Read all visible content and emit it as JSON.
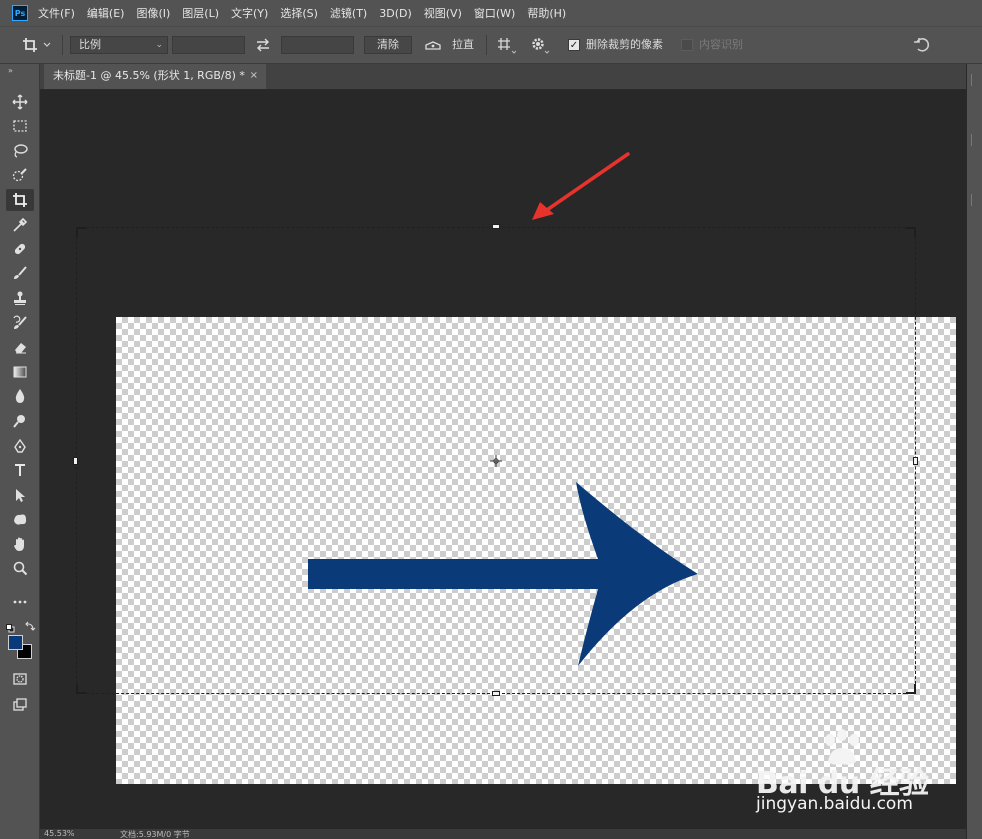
{
  "app": {
    "logo": "Ps"
  },
  "menu": {
    "items": [
      {
        "label": "文件(F)"
      },
      {
        "label": "编辑(E)"
      },
      {
        "label": "图像(I)"
      },
      {
        "label": "图层(L)"
      },
      {
        "label": "文字(Y)"
      },
      {
        "label": "选择(S)"
      },
      {
        "label": "滤镜(T)"
      },
      {
        "label": "3D(D)"
      },
      {
        "label": "视图(V)"
      },
      {
        "label": "窗口(W)"
      },
      {
        "label": "帮助(H)"
      }
    ]
  },
  "options_bar": {
    "ratio_select": "比例",
    "width_value": "",
    "height_value": "",
    "clear_button": "清除",
    "straighten_label": "拉直",
    "delete_cropped_label": "删除裁剪的像素",
    "delete_cropped_checked": true,
    "content_aware_label": "内容识别",
    "content_aware_checked": false
  },
  "document": {
    "tab_title": "未标题-1 @ 45.5% (形状 1, RGB/8) *",
    "close_glyph": "×",
    "arrow_color": "#0a3b78",
    "annotation_arrow_color": "#e8332d"
  },
  "toolbar": {
    "foreground_color": "#0a3b78",
    "background_color": "#000000",
    "tools": [
      {
        "name": "move-tool-icon"
      },
      {
        "name": "marquee-tool-icon"
      },
      {
        "name": "lasso-tool-icon"
      },
      {
        "name": "quick-selection-tool-icon"
      },
      {
        "name": "crop-tool-icon",
        "active": true
      },
      {
        "name": "eyedropper-tool-icon"
      },
      {
        "name": "healing-brush-tool-icon"
      },
      {
        "name": "brush-tool-icon"
      },
      {
        "name": "clone-stamp-tool-icon"
      },
      {
        "name": "history-brush-tool-icon"
      },
      {
        "name": "eraser-tool-icon"
      },
      {
        "name": "gradient-tool-icon"
      },
      {
        "name": "blur-tool-icon"
      },
      {
        "name": "dodge-tool-icon"
      },
      {
        "name": "pen-tool-icon"
      },
      {
        "name": "type-tool-icon"
      },
      {
        "name": "path-selection-tool-icon"
      },
      {
        "name": "custom-shape-tool-icon"
      },
      {
        "name": "hand-tool-icon"
      },
      {
        "name": "zoom-tool-icon"
      },
      {
        "name": "more-tools-icon"
      }
    ]
  },
  "status": {
    "zoom": "45.53%",
    "doc_info": "文档:5.93M/0 字节"
  },
  "watermark": {
    "brand": "Bai du 经验",
    "url": "jingyan.baidu.com"
  }
}
